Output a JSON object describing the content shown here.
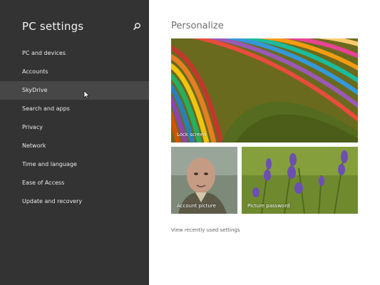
{
  "sidebar": {
    "title": "PC settings",
    "items": [
      {
        "label": "PC and devices"
      },
      {
        "label": "Accounts"
      },
      {
        "label": "SkyDrive"
      },
      {
        "label": "Search and apps"
      },
      {
        "label": "Privacy"
      },
      {
        "label": "Network"
      },
      {
        "label": "Time and language"
      },
      {
        "label": "Ease of Access"
      },
      {
        "label": "Update and recovery"
      }
    ],
    "selected_index": 2
  },
  "main": {
    "title": "Personalize",
    "tiles": {
      "lock_screen": "Lock screen",
      "account_picture": "Account picture",
      "picture_password": "Picture password"
    },
    "recent_link": "View recently used settings"
  },
  "icons": [
    "search-icon",
    "mouse-cursor-icon"
  ],
  "colors": {
    "sidebar_bg": "#333333",
    "selected_item_bg": "#474747",
    "page_bg": "#ffffff"
  }
}
